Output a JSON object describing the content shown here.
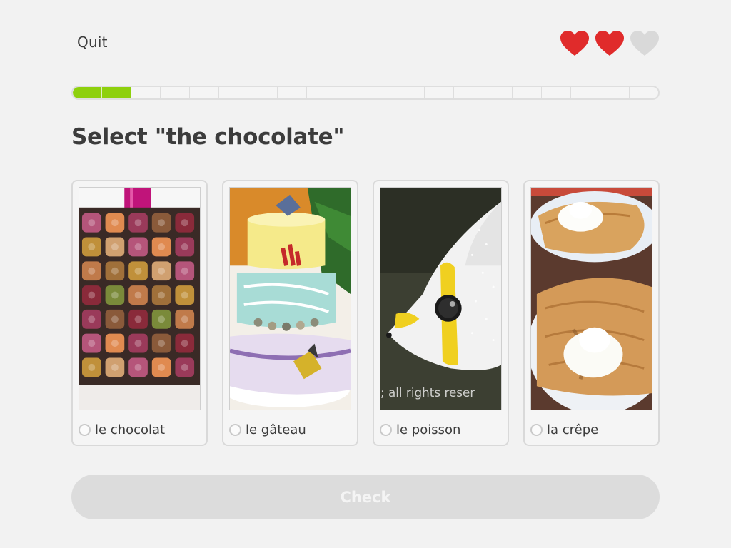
{
  "header": {
    "quit_label": "Quit",
    "hearts": [
      {
        "filled": true
      },
      {
        "filled": true
      },
      {
        "filled": false
      }
    ]
  },
  "progress": {
    "completed_fraction": 0.1,
    "segments": 20
  },
  "prompt": {
    "title": "Select \"the chocolate\""
  },
  "choices": [
    {
      "label": "le chocolat",
      "image": "chocolate-box-image"
    },
    {
      "label": "le gâteau",
      "image": "cake-image"
    },
    {
      "label": "le poisson",
      "image": "fish-image",
      "image_caption": "; all rights reser"
    },
    {
      "label": "la crêpe",
      "image": "crepe-image"
    }
  ],
  "footer": {
    "check_label": "Check"
  },
  "colors": {
    "heart_filled": "#e02b2b",
    "heart_empty": "#d9d9d9",
    "progress": "#8ed00d",
    "button_disabled": "#dcdcdc"
  }
}
